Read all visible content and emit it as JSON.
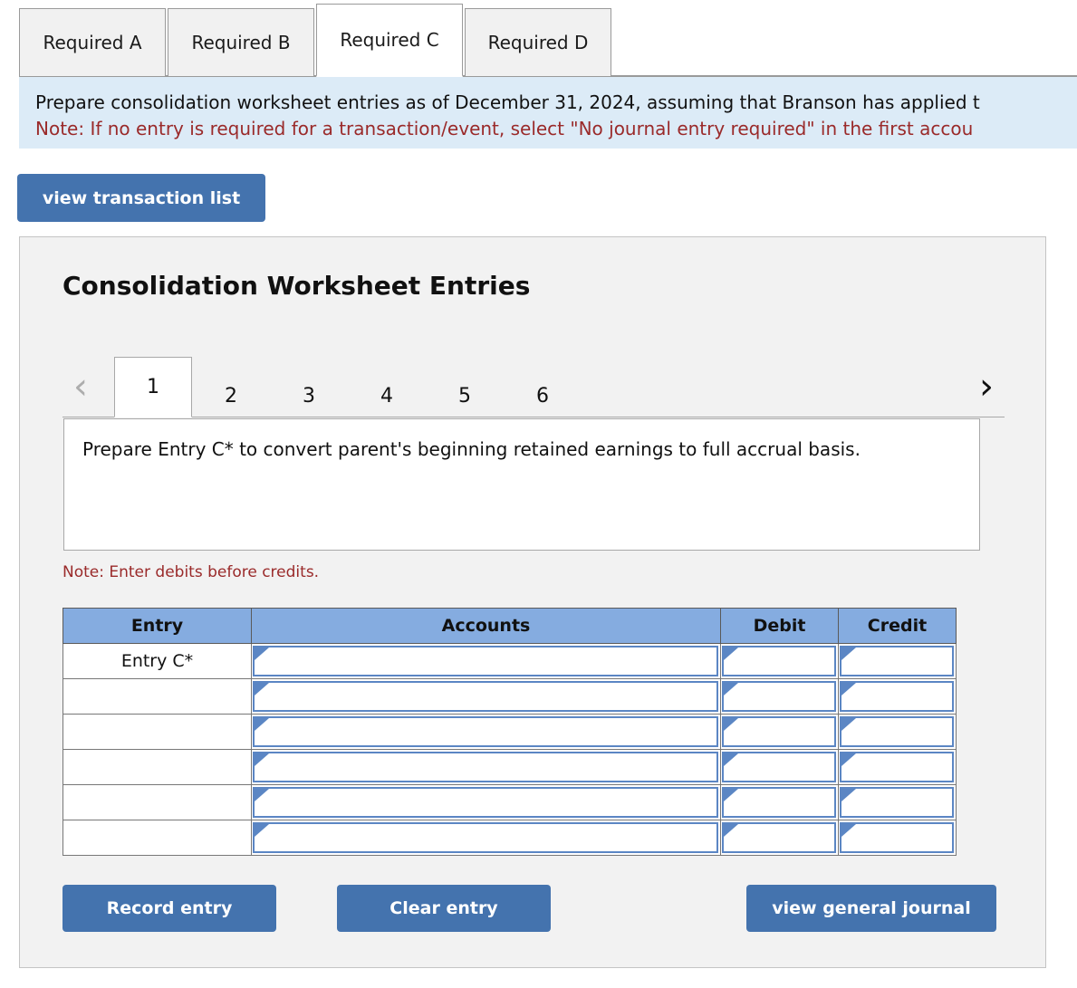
{
  "requirement_tabs": [
    {
      "label": "Required A",
      "active": false
    },
    {
      "label": "Required B",
      "active": false
    },
    {
      "label": "Required C",
      "active": true
    },
    {
      "label": "Required D",
      "active": false
    }
  ],
  "banner": {
    "instruction": "Prepare consolidation worksheet entries as of December 31, 2024, assuming that Branson has applied t",
    "note": "Note: If no entry is required for a transaction/event, select \"No journal entry required\" in the first accou",
    "background_color": "#dcebf7",
    "note_color": "#9a2a2a"
  },
  "toolbar": {
    "view_transaction_list_label": "view transaction list"
  },
  "panel": {
    "title": "Consolidation Worksheet Entries",
    "background_color": "#f2f2f2",
    "pager": {
      "prev_icon": "chevron-left-icon",
      "prev_glyph": "‹",
      "next_icon": "chevron-right-icon",
      "next_glyph": "›",
      "pages": [
        "1",
        "2",
        "3",
        "4",
        "5",
        "6"
      ],
      "active_page": "1"
    },
    "question": "Prepare Entry C* to convert parent's beginning retained earnings to full accrual basis.",
    "debit_note": "Note: Enter debits before credits.",
    "table": {
      "headers": [
        "Entry",
        "Accounts",
        "Debit",
        "Credit"
      ],
      "header_color": "#85ace0",
      "rows": [
        {
          "entry": "Entry C*",
          "account": "",
          "debit": "",
          "credit": ""
        },
        {
          "entry": "",
          "account": "",
          "debit": "",
          "credit": ""
        },
        {
          "entry": "",
          "account": "",
          "debit": "",
          "credit": ""
        },
        {
          "entry": "",
          "account": "",
          "debit": "",
          "credit": ""
        },
        {
          "entry": "",
          "account": "",
          "debit": "",
          "credit": ""
        },
        {
          "entry": "",
          "account": "",
          "debit": "",
          "credit": ""
        }
      ]
    },
    "actions": {
      "record_entry_label": "Record entry",
      "clear_entry_label": "Clear entry",
      "view_general_journal_label": "view general journal",
      "button_color": "#4473ae"
    }
  }
}
